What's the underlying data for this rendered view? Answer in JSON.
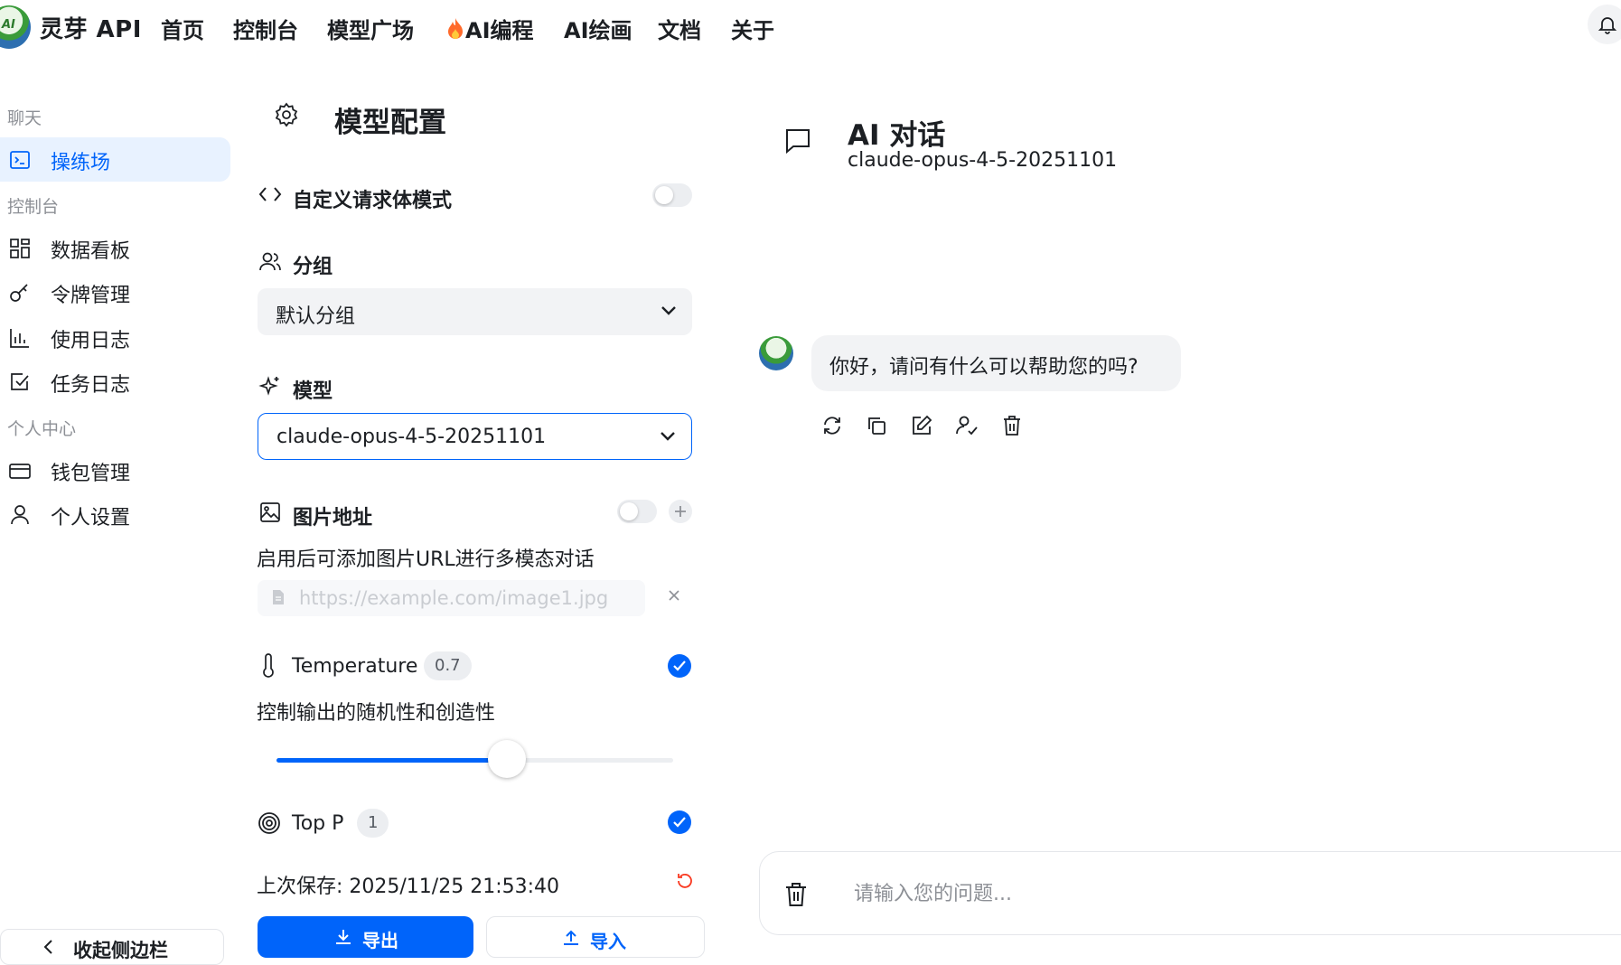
{
  "app": {
    "brand": "灵芽 API",
    "logo_text": "AI"
  },
  "nav": {
    "items": [
      {
        "label": "首页"
      },
      {
        "label": "控制台"
      },
      {
        "label": "模型广场"
      },
      {
        "label": "AI编程",
        "icon": "fire-icon"
      },
      {
        "label": "AI绘画"
      },
      {
        "label": "文档"
      },
      {
        "label": "关于"
      }
    ]
  },
  "sidebar": {
    "sections": [
      "聊天",
      "控制台",
      "个人中心"
    ],
    "items": [
      {
        "label": "操练场",
        "icon": "terminal-icon",
        "active": true
      },
      {
        "label": "数据看板",
        "icon": "dashboard-icon"
      },
      {
        "label": "令牌管理",
        "icon": "key-icon"
      },
      {
        "label": "使用日志",
        "icon": "bar-chart-icon"
      },
      {
        "label": "任务日志",
        "icon": "task-check-icon"
      },
      {
        "label": "钱包管理",
        "icon": "wallet-icon"
      },
      {
        "label": "个人设置",
        "icon": "user-icon"
      }
    ],
    "collapse_label": "收起侧边栏"
  },
  "config": {
    "title": "模型配置",
    "custom_body": {
      "label": "自定义请求体模式",
      "enabled": false
    },
    "group": {
      "label": "分组",
      "value": "默认分组"
    },
    "model": {
      "label": "模型",
      "value": "claude-opus-4-5-20251101"
    },
    "image": {
      "label": "图片地址",
      "enabled": false,
      "description": "启用后可添加图片URL进行多模态对话",
      "placeholder": "https://example.com/image1.jpg"
    },
    "temperature": {
      "label": "Temperature",
      "value": "0.7",
      "enabled": true,
      "description": "控制输出的随机性和创造性",
      "slider_fraction": 0.7
    },
    "top_p": {
      "label": "Top P",
      "value": "1",
      "enabled": true
    },
    "last_saved": "上次保存: 2025/11/25 21:53:40",
    "export_label": "导出",
    "import_label": "导入"
  },
  "chat": {
    "title": "AI 对话",
    "model": "claude-opus-4-5-20251101",
    "messages": [
      {
        "role": "assistant",
        "text": "你好，请问有什么可以帮助您的吗?"
      }
    ],
    "actions": [
      "refresh-icon",
      "copy-icon",
      "edit-icon",
      "switch-role-icon",
      "delete-icon"
    ],
    "input_placeholder": "请输入您的问题..."
  },
  "colors": {
    "primary": "#0064fa",
    "active_bg": "#e8f2ff",
    "muted": "#8d9096",
    "surface": "#f2f3f5"
  }
}
